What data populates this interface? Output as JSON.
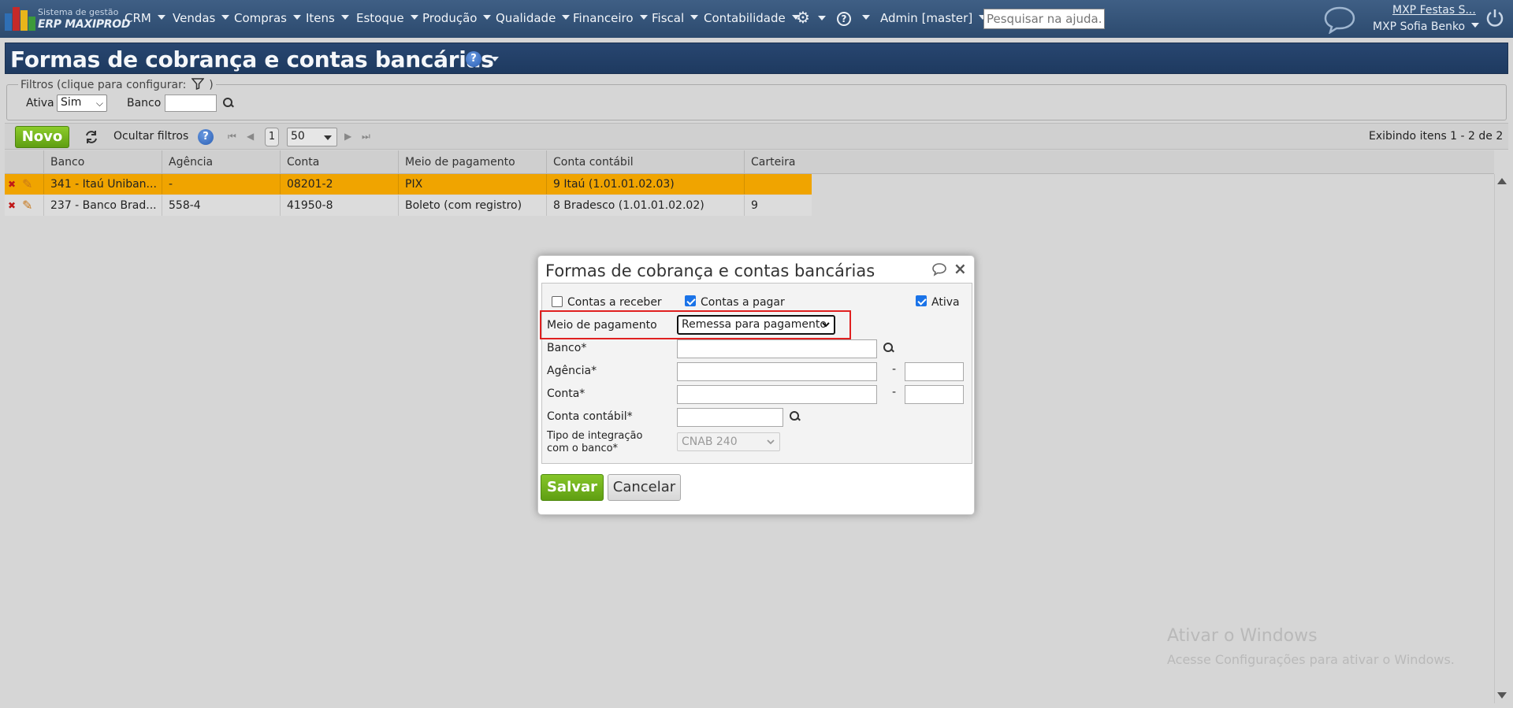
{
  "app": {
    "logo_line1": "Sistema de gestão",
    "logo_line2": "ERP MAXIPROD"
  },
  "nav": {
    "items": [
      "CRM",
      "Vendas",
      "Compras",
      "Itens",
      "Estoque",
      "Produção",
      "Qualidade",
      "Financeiro",
      "Fiscal",
      "Contabilidade"
    ],
    "user_menu": "Admin [master]",
    "search_placeholder": "Pesquisar na ajuda...",
    "company": "MXP Festas S...",
    "user": "MXP Sofia Benko"
  },
  "page": {
    "title": "Formas de cobrança e contas bancárias"
  },
  "filters": {
    "legend": "Filtros (clique para configurar:",
    "legend_close": ")",
    "ativa_label": "Ativa",
    "ativa_value": "Sim",
    "banco_label": "Banco"
  },
  "toolbar": {
    "new_label": "Novo",
    "hide_filters": "Ocultar filtros",
    "page": "1",
    "page_size": "50",
    "showing": "Exibindo itens 1 - 2 de 2"
  },
  "grid": {
    "columns": [
      "Banco",
      "Agência",
      "Conta",
      "Meio de pagamento",
      "Conta contábil",
      "Carteira"
    ],
    "rows": [
      [
        "341 - Itaú Uniban...",
        "-",
        "08201-2",
        "PIX",
        "9 Itaú (1.01.01.02.03)",
        ""
      ],
      [
        "237 - Banco Brad...",
        "558-4",
        "41950-8",
        "Boleto (com registro)",
        "8 Bradesco (1.01.01.02.02)",
        "9"
      ]
    ]
  },
  "modal": {
    "title": "Formas de cobrança e contas bancárias",
    "receber_label": "Contas a receber",
    "pagar_label": "Contas a pagar",
    "ativa_label": "Ativa",
    "meio_label": "Meio de pagamento",
    "meio_value": "Remessa para pagamento",
    "banco_label": "Banco*",
    "agencia_label": "Agência*",
    "conta_label": "Conta*",
    "dash": "-",
    "conta_contabil_label": "Conta contábil*",
    "integracao_label_1": "Tipo de integração",
    "integracao_label_2": "com o banco*",
    "integracao_value": "CNAB 240",
    "save_label": "Salvar",
    "cancel_label": "Cancelar"
  },
  "watermark": {
    "line1": "Ativar o Windows",
    "line2": "Acesse Configurações para ativar o Windows."
  },
  "colors": {
    "nav_bg": "#345478",
    "header_bg": "#234066",
    "row_selected": "#f0a400",
    "row_normal": "#dcdcdc",
    "green_button": "#6cae1a",
    "highlight_box": "#e02020"
  }
}
